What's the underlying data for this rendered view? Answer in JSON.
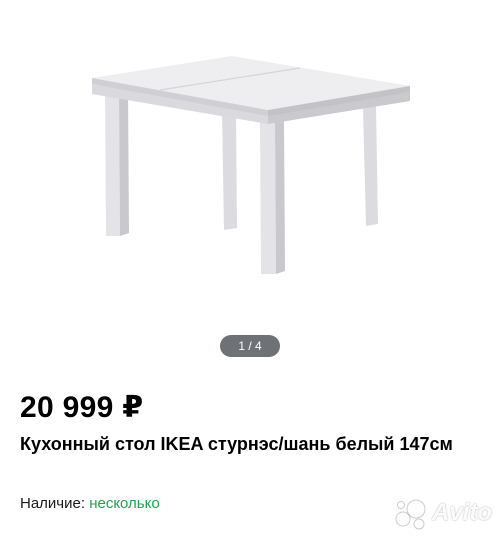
{
  "gallery": {
    "counter": "1 / 4"
  },
  "listing": {
    "price": "20 999 ₽",
    "title": "Кухонный стол IKEA стурнэс/шань белый 147см",
    "availability_label": "Наличие:",
    "availability_value": "несколько"
  },
  "watermark": {
    "text": "Avito"
  },
  "colors": {
    "availability": "#1fa54b",
    "counter_bg": "#6e7176"
  }
}
